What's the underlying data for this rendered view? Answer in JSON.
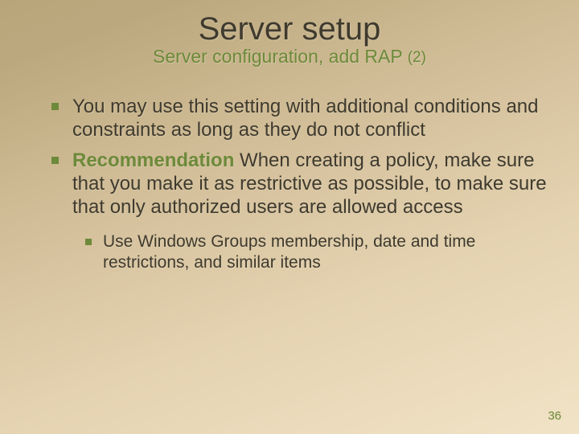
{
  "title": "Server setup",
  "subtitle_main": "Server configuration, add RAP ",
  "subtitle_paren": "(2)",
  "bullets": {
    "b1a": "You may use this setting with additional conditions and constraints as long as they do not conflict",
    "b1b_label": "Recommendation",
    "b1b_rest": " When creating a policy, make sure that you make it as restrictive as possible, to make sure that only authorized users are allowed access",
    "b2a": "Use Windows Groups membership, date and time restrictions, and similar items"
  },
  "page_number": "36"
}
